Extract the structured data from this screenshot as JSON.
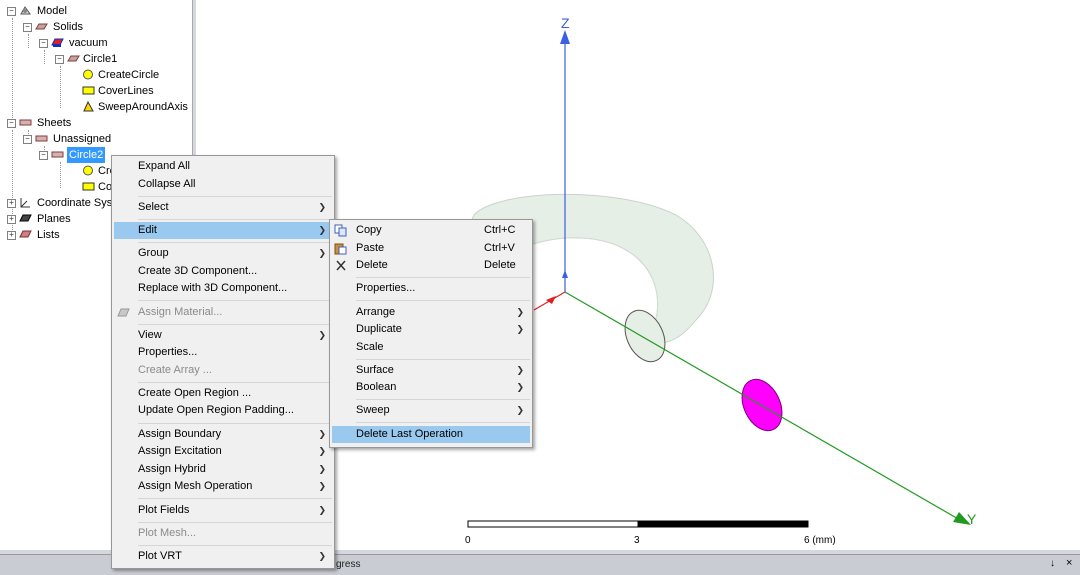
{
  "tree": {
    "model": "Model",
    "solids": "Solids",
    "vacuum": "vacuum",
    "circle1": "Circle1",
    "create_circle": "CreateCircle",
    "cover_lines": "CoverLines",
    "sweep_around_axis": "SweepAroundAxis",
    "sheets": "Sheets",
    "unassigned": "Unassigned",
    "circle2": "Circle2",
    "cre_trunc": "Cre",
    "co_trunc": "Co",
    "coordinate_systems": "Coordinate Syst",
    "planes": "Planes",
    "lists": "Lists"
  },
  "context_menu": {
    "expand_all": "Expand All",
    "collapse_all": "Collapse All",
    "select": "Select",
    "edit": "Edit",
    "group": "Group",
    "create_3d_component": "Create 3D Component...",
    "replace_3d_component": "Replace with 3D Component...",
    "assign_material": "Assign Material...",
    "view": "View",
    "properties": "Properties...",
    "create_array": "Create Array ...",
    "create_open_region": "Create Open Region ...",
    "update_open_region": "Update Open Region Padding...",
    "assign_boundary": "Assign Boundary",
    "assign_excitation": "Assign Excitation",
    "assign_hybrid": "Assign Hybrid",
    "assign_mesh_operation": "Assign Mesh Operation",
    "plot_fields": "Plot Fields",
    "plot_mesh": "Plot Mesh...",
    "plot_vrt": "Plot VRT"
  },
  "edit_submenu": {
    "copy": "Copy",
    "copy_sc": "Ctrl+C",
    "paste": "Paste",
    "paste_sc": "Ctrl+V",
    "delete": "Delete",
    "delete_sc": "Delete",
    "properties": "Properties...",
    "arrange": "Arrange",
    "duplicate": "Duplicate",
    "scale": "Scale",
    "surface": "Surface",
    "boolean": "Boolean",
    "sweep": "Sweep",
    "delete_last_operation": "Delete Last Operation"
  },
  "viewport": {
    "axis_z": "Z",
    "axis_y": "Y",
    "scale_0": "0",
    "scale_3": "3",
    "scale_6": "6 (mm)",
    "colors": {
      "z_axis": "#3a5fe0",
      "y_axis": "#1f9a1f",
      "x_axis": "#e02020",
      "torus": "#e8f0e8",
      "disk": "#ff00ff"
    }
  },
  "bottom": {
    "progress": "gress",
    "pin": "↓",
    "close": "×"
  }
}
